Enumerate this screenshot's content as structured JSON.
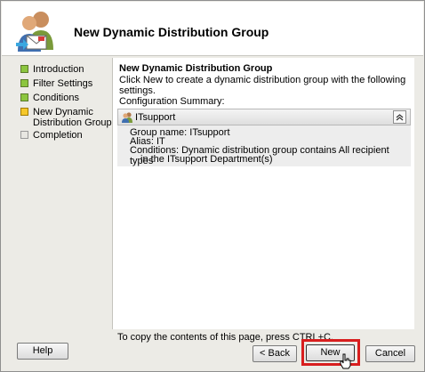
{
  "header": {
    "title": "New Dynamic Distribution Group",
    "icon": "user-group-mail-icon"
  },
  "nav": {
    "items": [
      {
        "label": "Introduction",
        "state": "done"
      },
      {
        "label": "Filter Settings",
        "state": "done"
      },
      {
        "label": "Conditions",
        "state": "done"
      },
      {
        "label": "New Dynamic",
        "label2": "Distribution Group",
        "state": "current"
      },
      {
        "label": "Completion",
        "state": "pending"
      }
    ]
  },
  "content": {
    "title": "New Dynamic Distribution Group",
    "description": "Click New to create a dynamic distribution group with the following settings.",
    "summary_label": "Configuration Summary:",
    "group_name": "ITsupport",
    "summary_lines": [
      "Group name: ITsupport",
      "Alias: IT",
      "Conditions: Dynamic distribution group contains All recipient types",
      "in the ITsupport Department(s)"
    ],
    "collapse_glyph": "⌃"
  },
  "footer": {
    "copy_hint": "To copy the contents of this page, press CTRL+C."
  },
  "buttons": {
    "help": "Help",
    "back": "< Back",
    "new": "New",
    "cancel": "Cancel"
  },
  "colors": {
    "done": "#8cc63f",
    "current": "#f6c82a",
    "highlight": "#d81e1e"
  }
}
